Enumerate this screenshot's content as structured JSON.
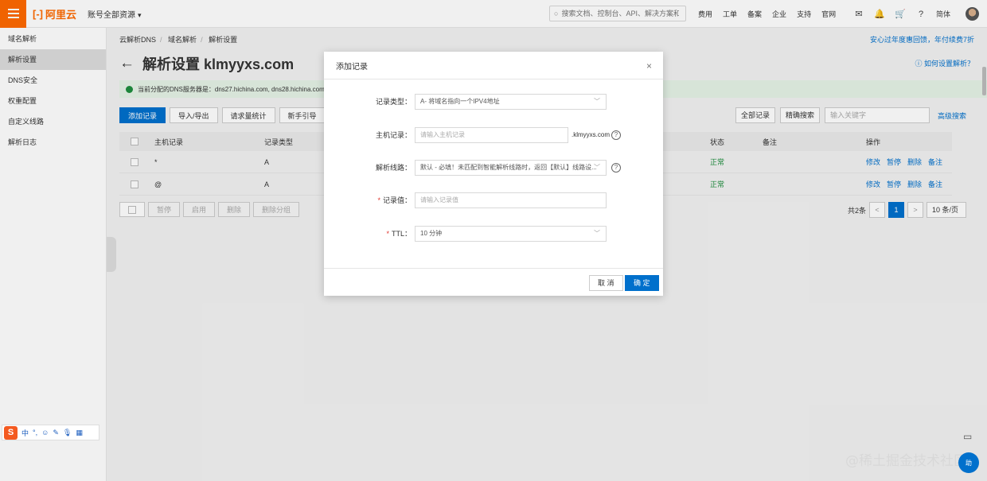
{
  "topbar": {
    "brand": "阿里云",
    "account": "账号全部资源",
    "search_placeholder": "搜索文档、控制台、API、解决方案和资源",
    "links": [
      "费用",
      "工单",
      "备案",
      "企业",
      "支持",
      "官网"
    ],
    "lang": "简体"
  },
  "sidebar": {
    "items": [
      "域名解析",
      "解析设置",
      "DNS安全",
      "权重配置",
      "自定义线路",
      "解析日志"
    ]
  },
  "main": {
    "breadcrumb": [
      "云解析DNS",
      "域名解析",
      "解析设置"
    ],
    "promo": "安心过年度惠回馈，年付续费7折",
    "title": "解析设置 klmyyxs.com",
    "help": "如何设置解析？",
    "notice": "当前分配的DNS服务器是：dns27.hichina.com, dns28.hichina.com",
    "buttons": [
      "添加记录",
      "导入/导出",
      "请求量统计",
      "新手引导"
    ],
    "filters": {
      "all_records": "全部记录",
      "precise": "精确搜索",
      "search_placeholder": "输入关键字",
      "advanced": "高级搜索"
    },
    "table": {
      "headers": [
        "主机记录",
        "记录类型",
        "状态",
        "备注",
        "操作"
      ],
      "rows": [
        {
          "host": "*",
          "type": "A",
          "status": "正常"
        },
        {
          "host": "@",
          "type": "A",
          "status": "正常"
        }
      ],
      "ops": [
        "修改",
        "暂停",
        "删除",
        "备注"
      ]
    },
    "bulk": [
      "暂停",
      "启用",
      "删除",
      "删除分组"
    ],
    "pager": {
      "total": "共2条",
      "prev": "<",
      "page": "1",
      "next": ">",
      "size": "10 条/页"
    }
  },
  "dialog": {
    "title": "添加记录",
    "close": "×",
    "fields": {
      "type_label": "记录类型：",
      "type_value": "A- 将域名指向一个IPV4地址",
      "host_label": "主机记录：",
      "host_placeholder": "请输入主机记录",
      "host_suffix": ".klmyyxs.com",
      "line_label": "解析线路：",
      "line_value": "默认 - 必填！未匹配到智能解析线路时，返回【默认】线路设...",
      "value_label": "记录值：",
      "value_placeholder": "请输入记录值",
      "ttl_label": "TTL：",
      "ttl_value": "10 分钟"
    },
    "cancel": "取 消",
    "confirm": "确 定"
  },
  "ime": {
    "logo": "S",
    "items": [
      "中",
      "°,",
      "☺",
      "✎",
      "🎙",
      "▦"
    ]
  },
  "watermark": "@稀土掘金技术社区",
  "help_button": "助"
}
